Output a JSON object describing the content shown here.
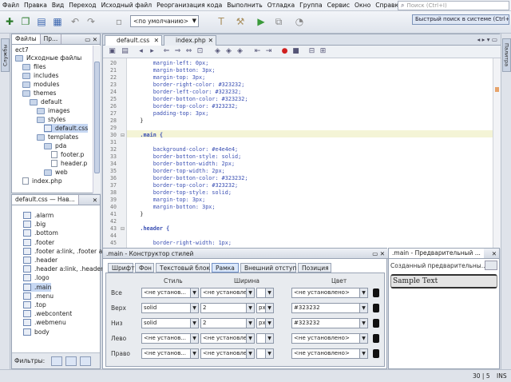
{
  "menu": [
    "Файл",
    "Правка",
    "Вид",
    "Переход",
    "Исходный файл",
    "Реорганизация кода",
    "Выполнить",
    "Отладка",
    "Группа",
    "Сервис",
    "Окно",
    "Справка"
  ],
  "search_placeholder": "Поиск (Ctrl+I)",
  "config": "<по умолчанию>",
  "quick_search": "Быстрый поиск в системе (Ctrl+I)",
  "left_tabs": {
    "services": "Службы"
  },
  "right_tabs": {
    "palette": "Палитра"
  },
  "files_panel": {
    "tab_files": "Файлы",
    "tab_projects": "Пр...",
    "root": "ect7",
    "items": [
      {
        "label": "Исходные файлы",
        "kind": "folder",
        "depth": 0
      },
      {
        "label": "files",
        "kind": "folder",
        "depth": 1
      },
      {
        "label": "includes",
        "kind": "folder",
        "depth": 1
      },
      {
        "label": "modules",
        "kind": "folder",
        "depth": 1
      },
      {
        "label": "themes",
        "kind": "folder",
        "depth": 1
      },
      {
        "label": "default",
        "kind": "folder",
        "depth": 2
      },
      {
        "label": "images",
        "kind": "folder",
        "depth": 3
      },
      {
        "label": "styles",
        "kind": "folder",
        "depth": 3
      },
      {
        "label": "default.css",
        "kind": "css",
        "depth": 4
      },
      {
        "label": "templates",
        "kind": "folder",
        "depth": 3
      },
      {
        "label": "pda",
        "kind": "folder",
        "depth": 4
      },
      {
        "label": "footer.p",
        "kind": "file",
        "depth": 5
      },
      {
        "label": "header.p",
        "kind": "file",
        "depth": 5
      },
      {
        "label": "web",
        "kind": "folder",
        "depth": 4
      },
      {
        "label": "index.php",
        "kind": "file",
        "depth": 1
      }
    ]
  },
  "nav_panel": {
    "title": "default.css — Нав...",
    "items": [
      ".alarm",
      ".big",
      ".bottom",
      ".footer",
      ".footer a:link, .footer a",
      ".header",
      ".header a:link, .header",
      ".logo",
      ".main",
      ".menu",
      ".top",
      ".webcontent",
      ".webmenu",
      "body"
    ],
    "selected": ".main",
    "filters_label": "Фильтры:"
  },
  "editor": {
    "tabs": [
      {
        "label": "default.css"
      },
      {
        "label": "index.php"
      }
    ],
    "lines": [
      {
        "n": "20",
        "t": "        margin-left: 0px;"
      },
      {
        "n": "21",
        "t": "        margin-botton: 3px;"
      },
      {
        "n": "22",
        "t": "        margin-top: 3px;"
      },
      {
        "n": "23",
        "t": "        border-right-color: #323232;"
      },
      {
        "n": "24",
        "t": "        border-left-color: #323232;"
      },
      {
        "n": "25",
        "t": "        border-botton-color: #323232;"
      },
      {
        "n": "26",
        "t": "        border-top-color: #323232;"
      },
      {
        "n": "27",
        "t": "        padding-top: 3px;"
      },
      {
        "n": "28",
        "t": "    }"
      },
      {
        "n": "29",
        "t": ""
      },
      {
        "n": "30",
        "t": "    .main {"
      },
      {
        "n": "31",
        "t": ""
      },
      {
        "n": "32",
        "t": "        background-color: #e4e4e4;"
      },
      {
        "n": "33",
        "t": "        border-botton-style: solid;"
      },
      {
        "n": "34",
        "t": "        border-botton-width: 2px;"
      },
      {
        "n": "35",
        "t": "        border-top-width: 2px;"
      },
      {
        "n": "36",
        "t": "        border-botton-color: #323232;"
      },
      {
        "n": "37",
        "t": "        border-top-color: #323232;"
      },
      {
        "n": "38",
        "t": "        border-top-style: solid;"
      },
      {
        "n": "39",
        "t": "        margin-top: 3px;"
      },
      {
        "n": "40",
        "t": "        margin-botton: 3px;"
      },
      {
        "n": "41",
        "t": "    }"
      },
      {
        "n": "42",
        "t": ""
      },
      {
        "n": "43",
        "t": "    .header {"
      },
      {
        "n": "44",
        "t": ""
      },
      {
        "n": "45",
        "t": "        border-right-width: 1px;"
      }
    ],
    "highlight_line": "30"
  },
  "style_builder": {
    "title": ".main - Конструктор стилей",
    "tabs": [
      "Шрифт",
      "Фон",
      "Текстовый блок",
      "Рамка",
      "Внешний отступ",
      "Позиция"
    ],
    "active_tab": "Рамка",
    "headers": {
      "style": "Стиль",
      "width": "Ширина",
      "color": "Цвет"
    },
    "rows": [
      {
        "label": "Все",
        "style": "<не установ...",
        "width": "<не установлено>",
        "unit": "",
        "color": "<не установлено>"
      },
      {
        "label": "Верх",
        "style": "solid",
        "width": "2",
        "unit": "px",
        "color": "#323232"
      },
      {
        "label": "Низ",
        "style": "solid",
        "width": "2",
        "unit": "px",
        "color": "#323232"
      },
      {
        "label": "Лево",
        "style": "<не установ...",
        "width": "<не установлено>",
        "unit": "",
        "color": "<не установлено>"
      },
      {
        "label": "Право",
        "style": "<не установ...",
        "width": "<не установлено>",
        "unit": "",
        "color": "<не установлено>"
      }
    ]
  },
  "preview": {
    "title": ".main - Предварительный ...",
    "caption": "Созданный предварительны...",
    "sample": "Sample Text"
  },
  "status": {
    "position": "30 | 5",
    "mode": "INS"
  }
}
